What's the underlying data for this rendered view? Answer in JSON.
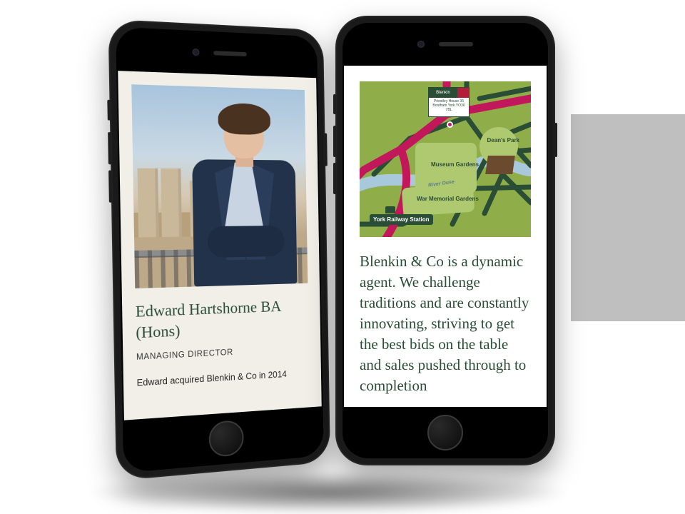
{
  "side_panel": {},
  "phone_left": {
    "profile": {
      "name": "Edward Hartshorne BA (Hons)",
      "role": "MANAGING DIRECTOR",
      "bio_line": "Edward acquired Blenkin & Co in 2014"
    }
  },
  "phone_right": {
    "map": {
      "brand_name": "Blenkin",
      "address_lines": "Priestley House 36 Bootham York YO30 7BL",
      "labels": {
        "museum_gardens": "Museum Gardens",
        "war_memorial_gardens": "War Memorial Gardens",
        "deans_park": "Dean's Park",
        "york_railway_station": "York Railway Station",
        "river": "River Ouse"
      }
    },
    "about_text": "Blenkin & Co is a dynamic agent. We challenge traditions and are constantly innovating, striving to get the best bids on the table and sales pushed through to completion"
  },
  "colors": {
    "brand_green": "#2a4d35",
    "brand_red": "#b31d3b",
    "map_bg": "#8fae4a",
    "road_pink": "#c2185b"
  }
}
